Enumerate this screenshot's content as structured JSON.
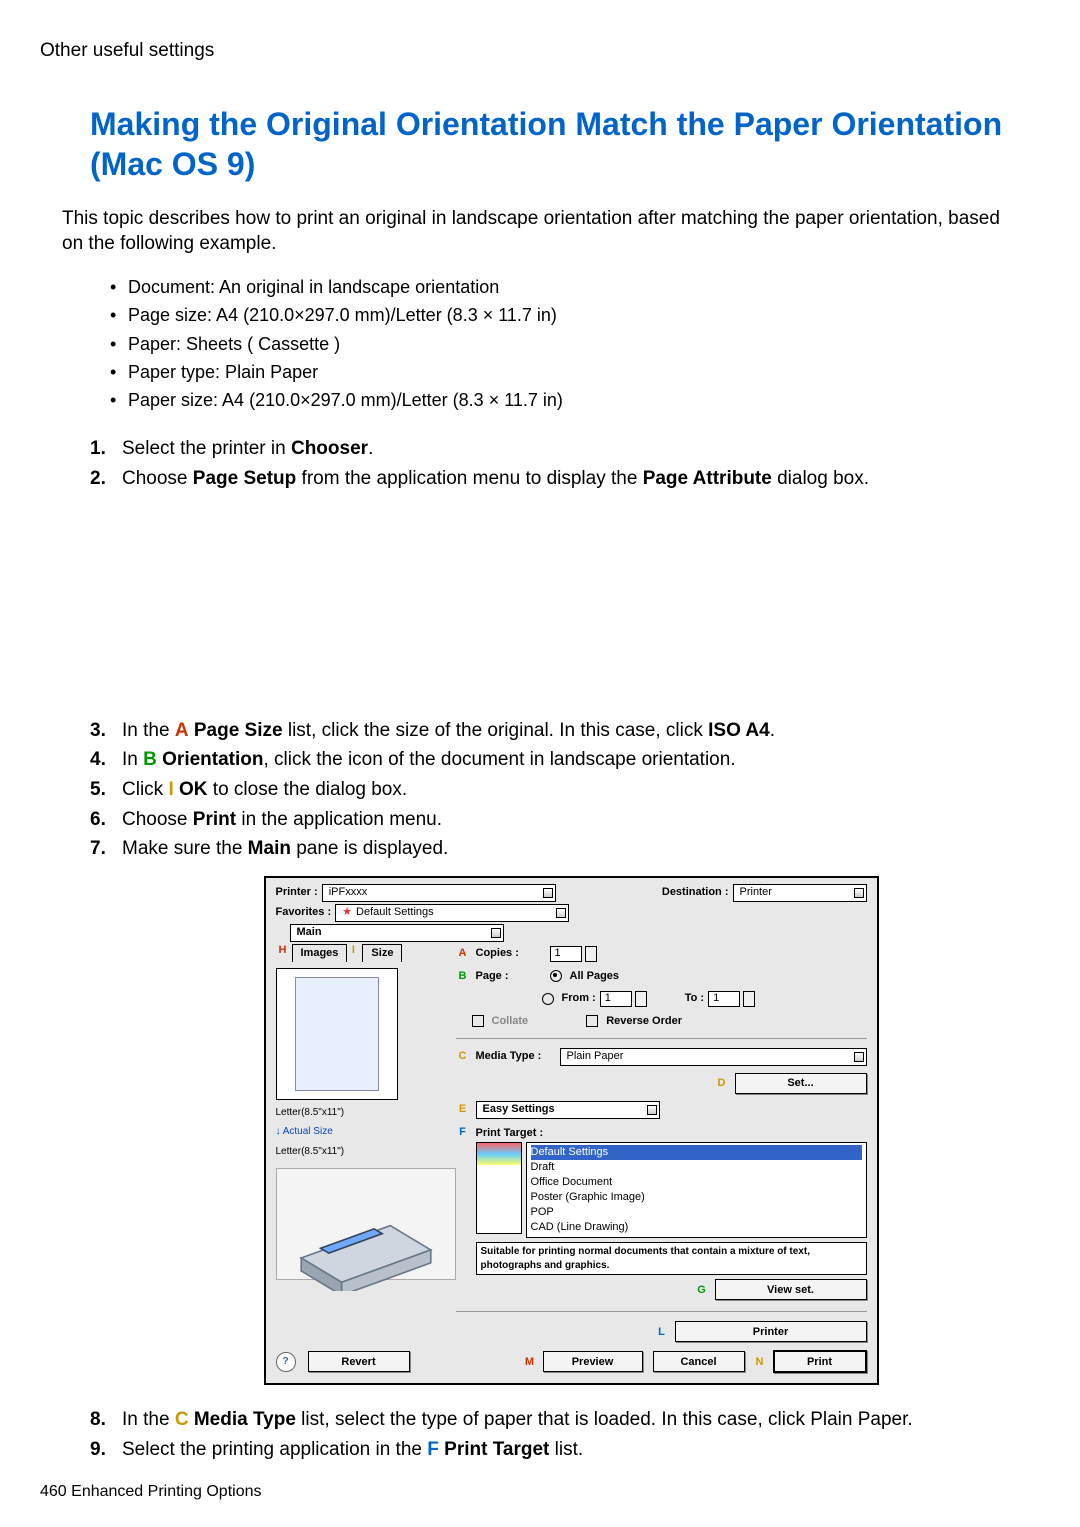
{
  "header_pre": "Other useful settings",
  "title": "Making the Original Orientation Match the Paper Orientation (Mac OS 9)",
  "intro": "This topic describes how to print an original in landscape orientation after matching the paper orientation, based on the following example.",
  "details": [
    "Document:  An original in landscape orientation",
    "Page size:  A4 (210.0×297.0 mm)/Letter (8.3 × 11.7 in)",
    "Paper:  Sheets ( Cassette )",
    "Paper type:  Plain Paper",
    "Paper size:  A4 (210.0×297.0 mm)/Letter (8.3 × 11.7 in)"
  ],
  "steps": {
    "s1": {
      "pre": "Select the printer in ",
      "b": "Chooser",
      "post": "."
    },
    "s2": {
      "pre": "Choose ",
      "b1": "Page Setup",
      "mid": " from the application menu to display the ",
      "b2": "Page Attribute",
      "post": " dialog box."
    },
    "s3": {
      "pre": "In the ",
      "cl": "A",
      "b1": "Page Size",
      "mid": " list, click the size of the original.  In this case, click ",
      "b2": "ISO A4",
      "post": "."
    },
    "s4": {
      "pre": "In ",
      "cl": "B",
      "b1": "Orientation",
      "post": ", click the icon of the document in landscape orientation."
    },
    "s5": {
      "pre": "Click ",
      "cl": "I",
      "b1": "OK",
      "post": " to close the dialog box."
    },
    "s6": {
      "pre": "Choose ",
      "b1": "Print",
      "post": " in the application menu."
    },
    "s7": {
      "pre": "Make sure the ",
      "b1": "Main",
      "post": " pane is displayed."
    },
    "s8": {
      "pre": "In the ",
      "cl": "C",
      "b1": "Media Type",
      "post": " list, select the type of paper that is loaded.  In this case, click Plain Paper."
    },
    "s9": {
      "pre": "Select the printing application in the ",
      "cl": "F",
      "b1": "Print Target",
      "post": " list."
    }
  },
  "dialog": {
    "printer_label": "Printer :",
    "printer_val": "iPFxxxx",
    "dest_label": "Destination :",
    "dest_val": "Printer",
    "fav_label": "Favorites :",
    "fav_val": "Default Settings",
    "pane": "Main",
    "tab_images": "Images",
    "tab_size": "Size",
    "copies_label": "Copies :",
    "copies_val": "1",
    "page_label": "Page :",
    "all_pages": "All Pages",
    "from_label": "From :",
    "from_val": "1",
    "to_label": "To :",
    "to_val": "1",
    "collate": "Collate",
    "reverse": "Reverse Order",
    "media_label": "Media Type :",
    "media_val": "Plain Paper",
    "set_btn": "Set...",
    "easy_label": "Easy Settings",
    "print_target_label": "Print Target :",
    "targets": [
      "Default Settings",
      "Draft",
      "Office Document",
      "Poster (Graphic Image)",
      "POP",
      "CAD (Line Drawing)"
    ],
    "desc": "Suitable for printing normal documents that contain a mixture of text, photographs and graphics.",
    "viewset": "View set.",
    "printer_btn": "Printer",
    "revert": "Revert",
    "preview": "Preview",
    "cancel": "Cancel",
    "print": "Print",
    "size1": "Letter(8.5\"x11\")",
    "actual": "Actual Size",
    "size2": "Letter(8.5\"x11\")",
    "markers": {
      "A": "A",
      "B": "B",
      "C": "C",
      "D": "D",
      "E": "E",
      "F": "F",
      "G": "G",
      "H": "H",
      "I": "I",
      "L": "L",
      "M": "M",
      "N": "N"
    }
  },
  "footer": "460  Enhanced Printing Options"
}
